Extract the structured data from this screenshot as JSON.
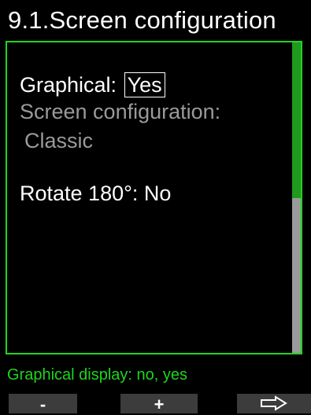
{
  "header": {
    "title": "9.1.Screen configuration"
  },
  "settings": {
    "graphical_label": "Graphical:",
    "graphical_value": "Yes",
    "screen_config_label": "Screen configuration:",
    "screen_config_value": "Classic",
    "rotate_label": "Rotate 180°:",
    "rotate_value": "No"
  },
  "scrollbar": {
    "position_fraction": 0.5
  },
  "help": {
    "text": "Graphical display: no, yes"
  },
  "softkeys": {
    "minus_label": "-",
    "plus_label": "+",
    "next_icon": "outline-right-arrow-icon"
  },
  "colors": {
    "accent": "#1fd51f",
    "background": "#000000",
    "disabled_text": "#9a9a9a",
    "softkey_bg": "#3c3c3c"
  }
}
